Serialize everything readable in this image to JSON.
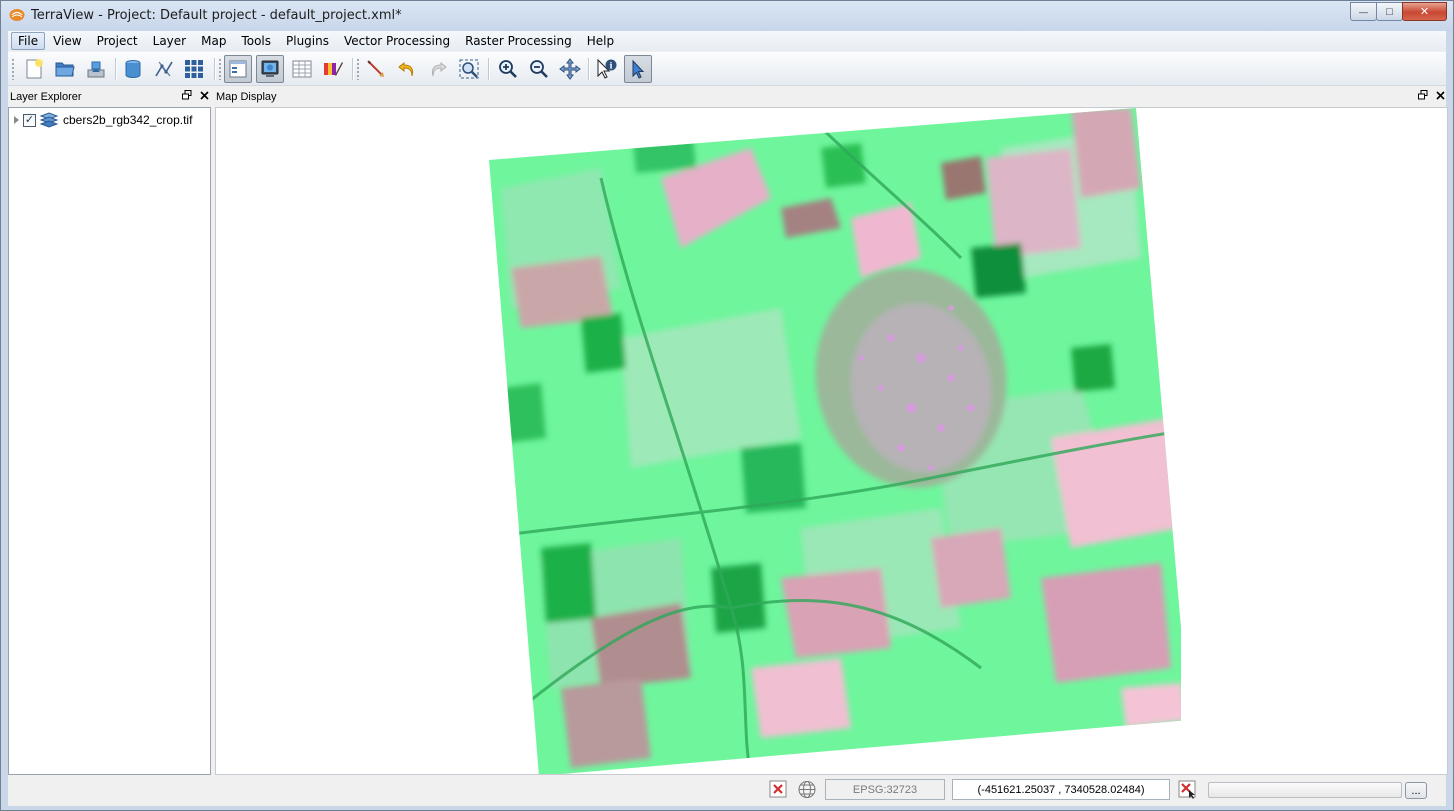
{
  "window": {
    "title": "TerraView - Project: Default project - default_project.xml*",
    "minimize": "—",
    "maximize": "□",
    "close": "✕"
  },
  "menubar": {
    "items": [
      {
        "label": "File"
      },
      {
        "label": "View"
      },
      {
        "label": "Project"
      },
      {
        "label": "Layer"
      },
      {
        "label": "Map"
      },
      {
        "label": "Tools"
      },
      {
        "label": "Plugins"
      },
      {
        "label": "Vector Processing"
      },
      {
        "label": "Raster Processing"
      },
      {
        "label": "Help"
      }
    ]
  },
  "toolbar": {
    "icons": [
      "new-project-icon",
      "open-project-icon",
      "save-project-icon",
      "data-source-icon",
      "geometry-icon",
      "grid-icon",
      "layer-explorer-icon",
      "map-display-icon",
      "table-icon",
      "style-icon",
      "measure-icon",
      "undo-icon",
      "redo-icon",
      "zoom-extent-icon",
      "zoom-in-icon",
      "zoom-out-icon",
      "pan-icon",
      "info-icon",
      "select-icon"
    ]
  },
  "layer_explorer": {
    "title": "Layer Explorer",
    "layers": [
      {
        "name": "cbers2b_rgb342_crop.tif",
        "checked": "✓"
      }
    ]
  },
  "map_display": {
    "title": "Map Display"
  },
  "statusbar": {
    "srid": "EPSG:32723",
    "coordinates": "(-451621.25037 , 7340528.02484)",
    "more": "..."
  },
  "colors": {
    "accent": "#c74832",
    "raster_base": "#6ff59c",
    "field_pink": "#d9a8b8"
  }
}
